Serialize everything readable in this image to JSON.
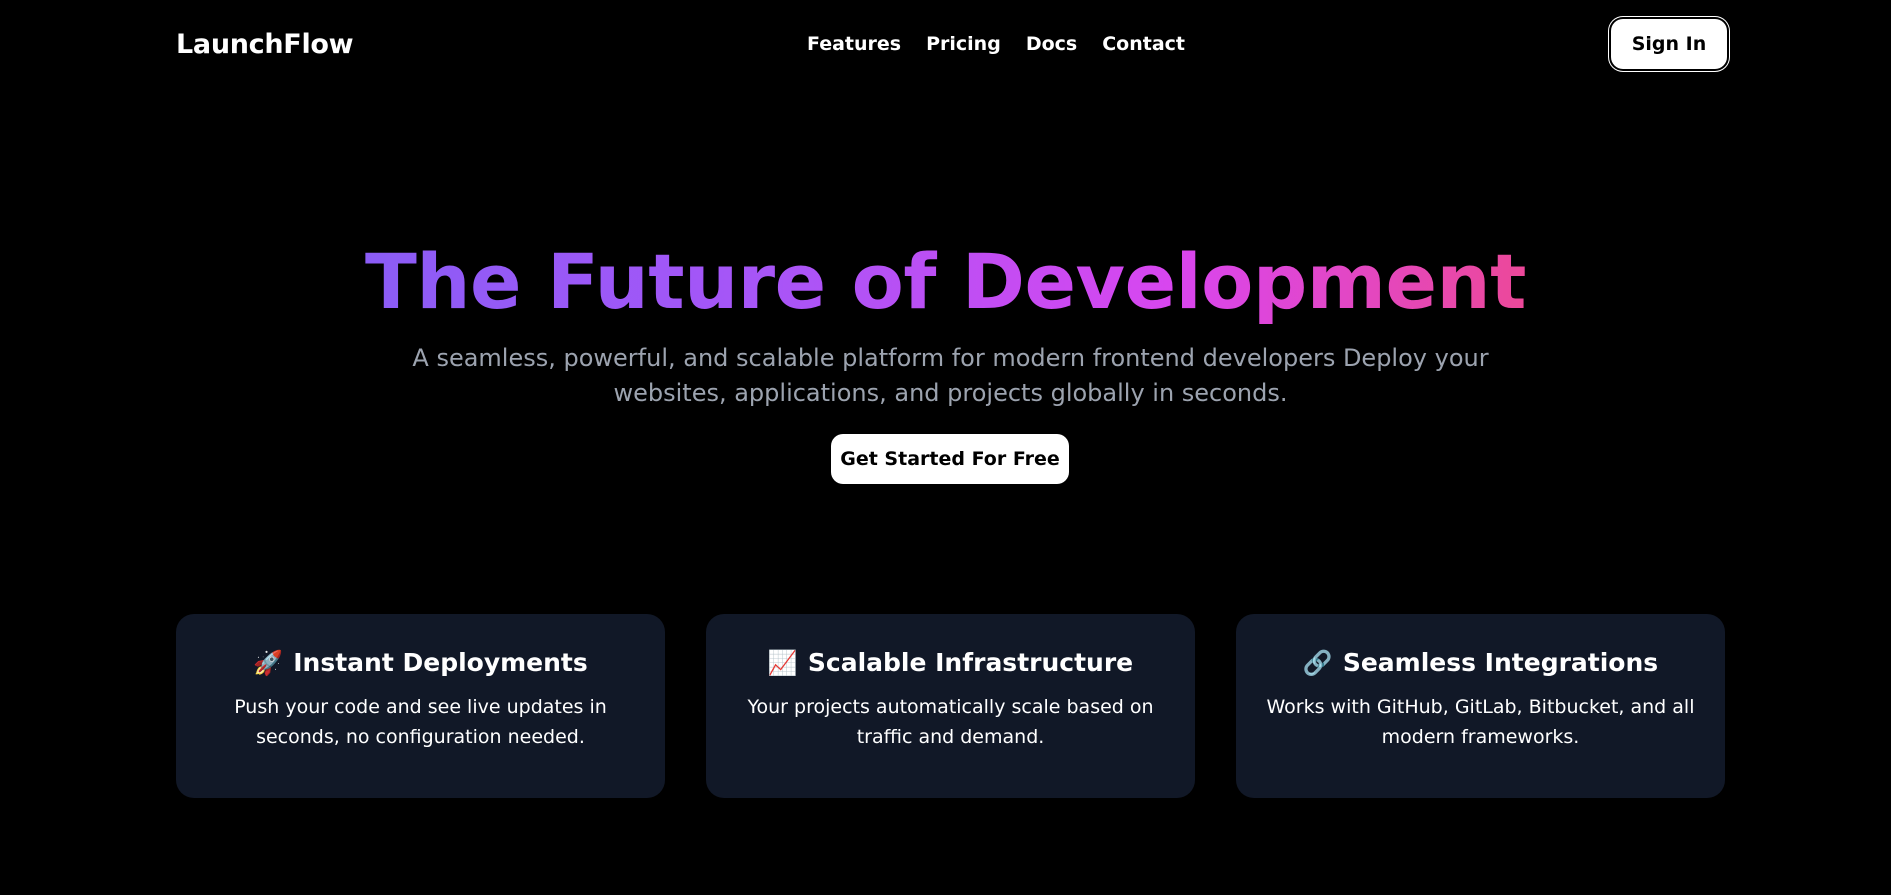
{
  "nav": {
    "brand": "LaunchFlow",
    "links": [
      "Features",
      "Pricing",
      "Docs",
      "Contact"
    ],
    "sign_in": "Sign In"
  },
  "hero": {
    "title": "The Future of Development",
    "subtitle": "A seamless, powerful, and scalable platform for modern frontend developers Deploy your websites, applications, and projects globally in seconds.",
    "cta": "Get Started For Free",
    "gradient": [
      "#8b5cf6",
      "#ec4899"
    ]
  },
  "features": [
    {
      "icon": "🚀",
      "icon_name": "rocket-icon",
      "title": "Instant Deployments",
      "description": "Push your code and see live updates in seconds, no configuration needed."
    },
    {
      "icon": "📈",
      "icon_name": "chart-increasing-icon",
      "title": "Scalable Infrastructure",
      "description": "Your projects automatically scale based on traffic and demand."
    },
    {
      "icon": "🔗",
      "icon_name": "link-icon",
      "title": "Seamless Integrations",
      "description": "Works with GitHub, GitLab, Bitbucket, and all modern frameworks."
    }
  ],
  "colors": {
    "background": "#000000",
    "card_background": "#111827",
    "subtitle_text": "#9ca3af"
  }
}
